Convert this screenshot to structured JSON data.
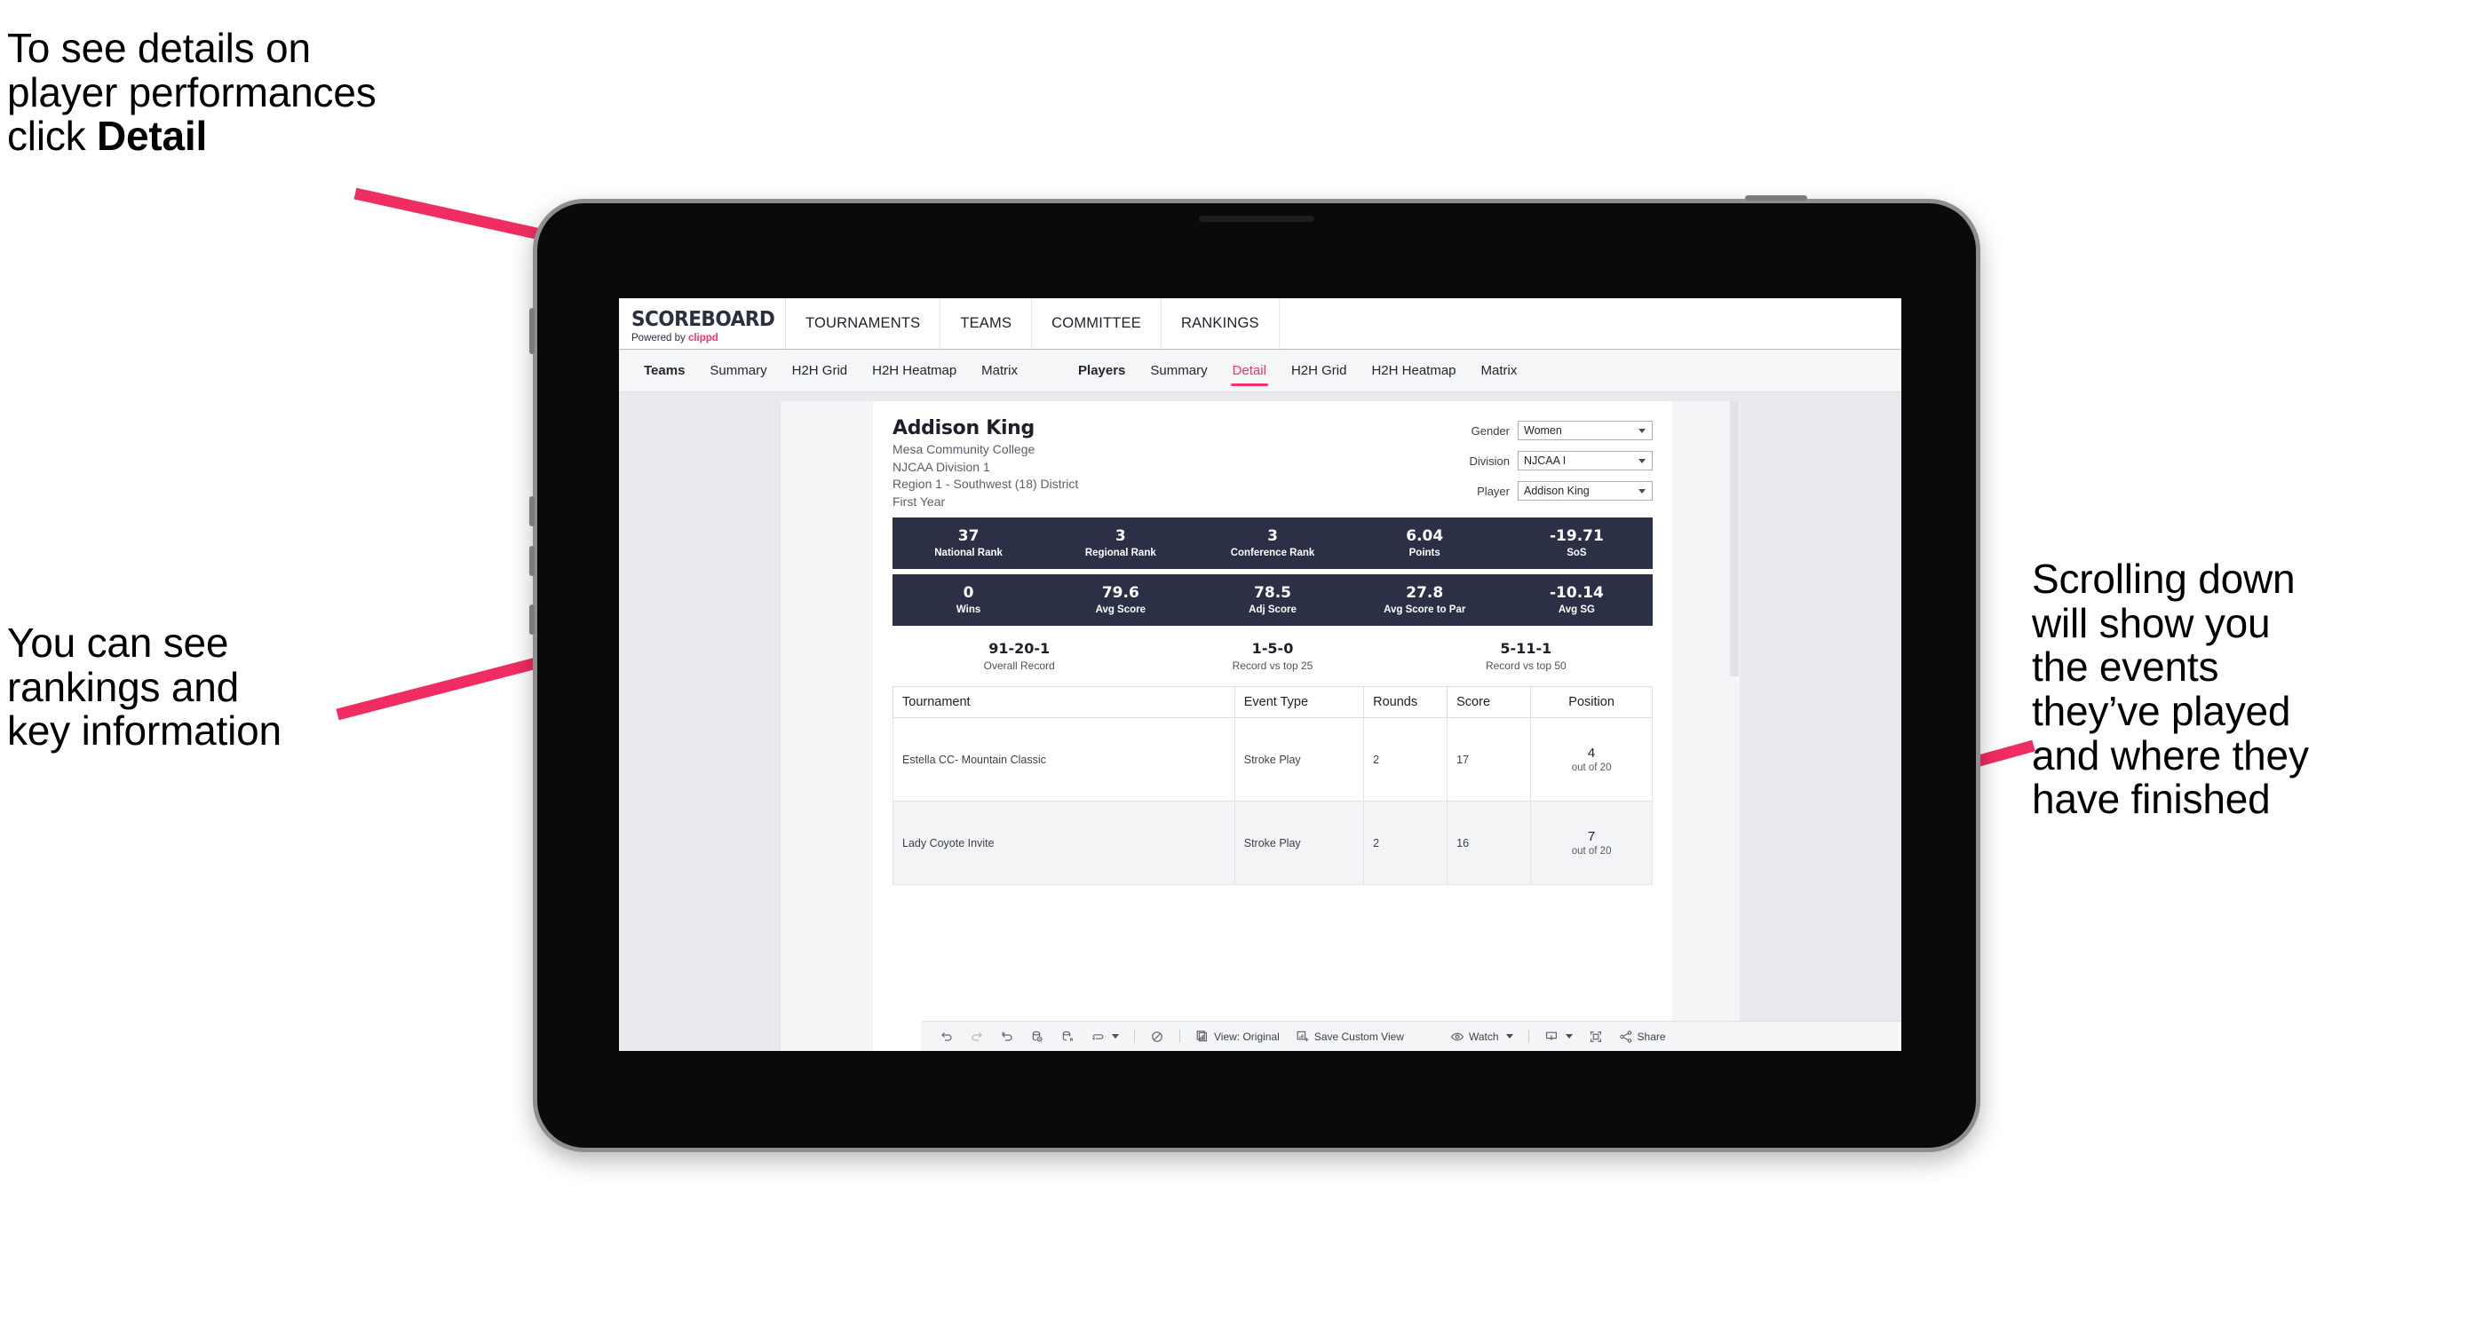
{
  "annotations": {
    "detail": "To see details on\nplayer performances\nclick ",
    "detail_bold": "Detail",
    "rankings": "You can see\nrankings and\nkey information",
    "scrolling": "Scrolling down\nwill show you\nthe events\nthey’ve played\nand where they\nhave finished"
  },
  "colors": {
    "accent_pink": "#f2346a",
    "stat_bar_navy": "#2c3047",
    "page_bg": "#e9eaee"
  },
  "app": {
    "logo": {
      "word": "SCOREBOARD",
      "powered_prefix": "Powered by ",
      "brand": "clippd"
    },
    "nav": [
      "TOURNAMENTS",
      "TEAMS",
      "COMMITTEE",
      "RANKINGS"
    ],
    "tabs": {
      "teams_group": [
        "Teams",
        "Summary",
        "H2H Grid",
        "H2H Heatmap",
        "Matrix"
      ],
      "players_group": [
        "Players",
        "Summary",
        "Detail",
        "H2H Grid",
        "H2H Heatmap",
        "Matrix"
      ],
      "active": "Detail"
    }
  },
  "player": {
    "name": "Addison King",
    "school": "Mesa Community College",
    "division": "NJCAA Division 1",
    "region": "Region 1 - Southwest (18) District",
    "year": "First Year"
  },
  "filters": [
    {
      "label": "Gender",
      "value": "Women"
    },
    {
      "label": "Division",
      "value": "NJCAA I"
    },
    {
      "label": "Player",
      "value": "Addison King"
    }
  ],
  "stats_row1": [
    {
      "value": "37",
      "label": "National Rank"
    },
    {
      "value": "3",
      "label": "Regional Rank"
    },
    {
      "value": "3",
      "label": "Conference Rank"
    },
    {
      "value": "6.04",
      "label": "Points"
    },
    {
      "value": "-19.71",
      "label": "SoS"
    }
  ],
  "stats_row2": [
    {
      "value": "0",
      "label": "Wins"
    },
    {
      "value": "79.6",
      "label": "Avg Score"
    },
    {
      "value": "78.5",
      "label": "Adj Score"
    },
    {
      "value": "27.8",
      "label": "Avg Score to Par"
    },
    {
      "value": "-10.14",
      "label": "Avg SG"
    }
  ],
  "records": [
    {
      "value": "91-20-1",
      "label": "Overall Record"
    },
    {
      "value": "1-5-0",
      "label": "Record vs top 25"
    },
    {
      "value": "5-11-1",
      "label": "Record vs top 50"
    }
  ],
  "events_table": {
    "columns": [
      "Tournament",
      "Event Type",
      "Rounds",
      "Score",
      "Position"
    ],
    "rows": [
      {
        "tournament": "Estella CC- Mountain Classic",
        "event_type": "Stroke Play",
        "rounds": "2",
        "score": "17",
        "position_num": "4",
        "position_of": "out of 20"
      },
      {
        "tournament": "Lady Coyote Invite",
        "event_type": "Stroke Play",
        "rounds": "2",
        "score": "16",
        "position_num": "7",
        "position_of": "out of 20"
      }
    ]
  },
  "toolbar": {
    "undo": "undo-icon",
    "redo": "redo-icon",
    "revert": "revert-icon",
    "refresh": "refresh-data-icon",
    "pause": "pause-auto-update-icon",
    "view_original_label": "View: Original",
    "save_custom_view_label": "Save Custom View",
    "watch_label": "Watch",
    "share_label": "Share"
  }
}
